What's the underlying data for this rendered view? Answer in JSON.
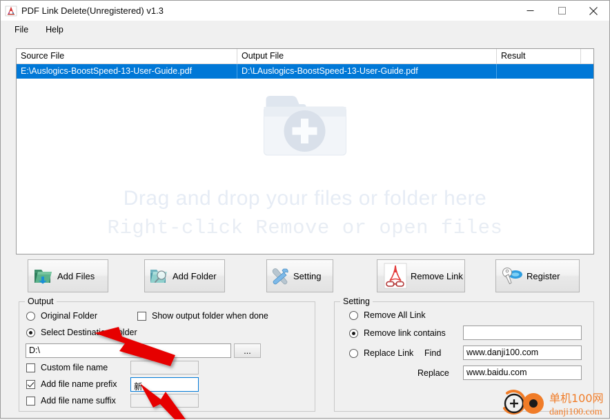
{
  "window": {
    "title": "PDF Link Delete(Unregistered) v1.3",
    "icon": "pdf-app-icon",
    "controls": {
      "minimize": "minimize-icon",
      "maximize": "maximize-icon",
      "close": "close-icon"
    }
  },
  "menu": {
    "items": [
      {
        "label": "File"
      },
      {
        "label": "Help"
      }
    ]
  },
  "filelist": {
    "columns": [
      "Source File",
      "Output File",
      "Result"
    ],
    "rows": [
      {
        "source": "E:\\Auslogics-BoostSpeed-13-User-Guide.pdf",
        "output": "D:\\LAuslogics-BoostSpeed-13-User-Guide.pdf",
        "result": "",
        "selected": true
      }
    ],
    "dropzone": {
      "icon": "folder-add-icon",
      "line1": "Drag and drop your files or folder here",
      "line2": "Right-click Remove or open files"
    },
    "selection_color": "#0078d7"
  },
  "toolbar": {
    "buttons": [
      {
        "label": "Add Files",
        "icon": "folder-add-files-icon"
      },
      {
        "label": "Add Folder",
        "icon": "folder-search-icon"
      },
      {
        "label": "Setting",
        "icon": "tools-wrench-hammer-icon"
      },
      {
        "label": "Remove Link",
        "icon": "pdf-remove-link-icon"
      },
      {
        "label": "Register",
        "icon": "key-icon"
      }
    ]
  },
  "output": {
    "title": "Output",
    "original_folder": {
      "label": "Original Folder",
      "checked": false
    },
    "select_destination": {
      "label": "Select Destination Folder",
      "checked": true
    },
    "show_output_folder": {
      "label": "Show output folder when done",
      "checked": false
    },
    "destination_path": {
      "value": "D:\\",
      "placeholder": ""
    },
    "browse_label": "...",
    "custom_file_name": {
      "label": "Custom file name",
      "checked": false,
      "value": "",
      "enabled": false
    },
    "add_prefix": {
      "label": "Add file name prefix",
      "checked": true,
      "value": "新",
      "enabled": true
    },
    "add_suffix": {
      "label": "Add file name suffix",
      "checked": false,
      "value": "",
      "enabled": false
    }
  },
  "setting": {
    "title": "Setting",
    "remove_all": {
      "label": "Remove All Link",
      "checked": false
    },
    "remove_contains": {
      "label": "Remove link contains",
      "checked": true,
      "value": ""
    },
    "replace_link": {
      "label": "Replace Link",
      "checked": false
    },
    "find_label": "Find",
    "find_value": "www.danji100.com",
    "replace_label": "Replace",
    "replace_value": "www.baidu.com"
  },
  "annotations": {
    "arrow_color": "#e60000",
    "arrows": [
      {
        "name": "arrow-to-select-destination-radio"
      },
      {
        "name": "arrow-to-prefix-input"
      }
    ]
  },
  "watermark": {
    "text_cn": "单机100网",
    "text_url": "danji100.com",
    "color": "#f07c28"
  }
}
